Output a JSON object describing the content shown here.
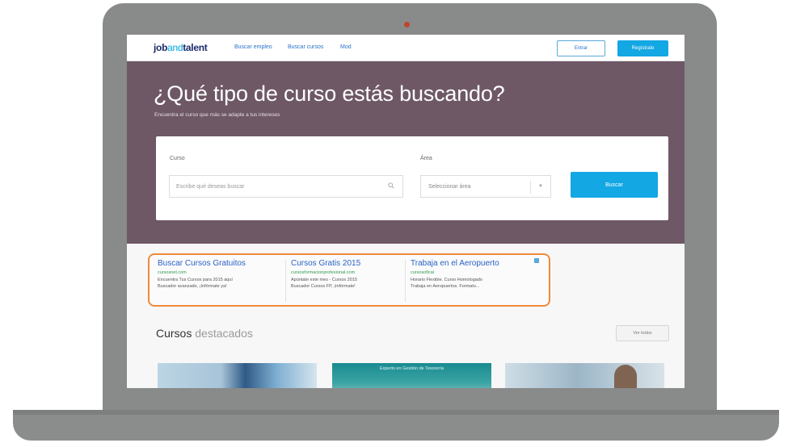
{
  "header": {
    "logo_part1": "job",
    "logo_part2": "and",
    "logo_part3": "talent",
    "nav": [
      "Buscar empleo",
      "Buscar cursos",
      "Mod"
    ],
    "enter_label": "Entrar",
    "register_label": "Regístrate"
  },
  "hero": {
    "title": "¿Qué tipo de curso estás buscando?",
    "subtitle": "Encuentra el curso que más se adapte a tus intereses",
    "curso_label": "Curso",
    "curso_placeholder": "Escribe qué deseas buscar",
    "area_label": "Área",
    "area_selected": "Seleccionar área",
    "search_label": "Buscar"
  },
  "ads": [
    {
      "title": "Buscar Cursos Gratuitos",
      "url": "cursosnet.com",
      "desc1": "Encuentra Tus Cursos para 2015 aquí",
      "desc2": "Buscador avanzado, ¡Infórmate ya!"
    },
    {
      "title": "Cursos Gratis 2015",
      "url": "cursosformacionprofesional.com",
      "desc1": "Apúntate este mes - Cursos 2015",
      "desc2": "Buscador Cursos FP, ¡Infórmate!"
    },
    {
      "title": "Trabaja en el Aeropuerto",
      "url": "cursosofical",
      "desc1": "Horario Flexible. Curso Homologado",
      "desc2": "Trabaja en Aeropuertos. Formato..."
    }
  ],
  "featured": {
    "title_bold": "Cursos",
    "title_light": "destacados",
    "see_all": "Ver todos",
    "thumb2_caption": "Experto en Gestión de Tesorería"
  },
  "colors": {
    "hero_bg": "#6e5866",
    "accent_blue": "#13a7e4",
    "highlight_orange": "#ef8a3a",
    "logo_dark": "#1c2b6b"
  }
}
